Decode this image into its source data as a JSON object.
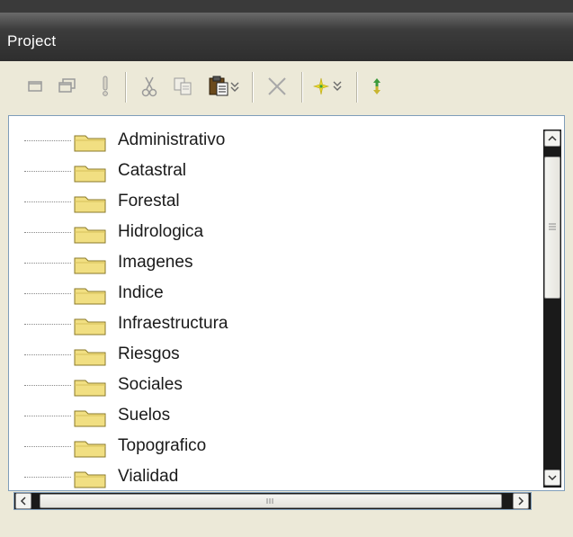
{
  "window": {
    "title": "Project"
  },
  "toolbar": {
    "buttons": [
      {
        "icon": "window-restore-icon"
      },
      {
        "icon": "window-cascade-icon"
      },
      {
        "icon": "exclamation-icon"
      },
      {
        "icon": "cut-icon"
      },
      {
        "icon": "copy-icon"
      },
      {
        "icon": "paste-icon"
      },
      {
        "icon": "delete-icon"
      },
      {
        "icon": "star-icon"
      },
      {
        "icon": "refresh-icon"
      }
    ]
  },
  "tree": {
    "items": [
      {
        "label": "Administrativo"
      },
      {
        "label": "Catastral"
      },
      {
        "label": "Forestal"
      },
      {
        "label": "Hidrologica"
      },
      {
        "label": "Imagenes"
      },
      {
        "label": "Indice"
      },
      {
        "label": "Infraestructura"
      },
      {
        "label": "Riesgos"
      },
      {
        "label": "Sociales"
      },
      {
        "label": "Suelos"
      },
      {
        "label": "Topografico"
      },
      {
        "label": "Vialidad"
      }
    ]
  },
  "colors": {
    "titlebar": "#2e2e2e",
    "panel": "#ece9d8",
    "folder": "#f1df82",
    "border": "#7f9db9"
  }
}
